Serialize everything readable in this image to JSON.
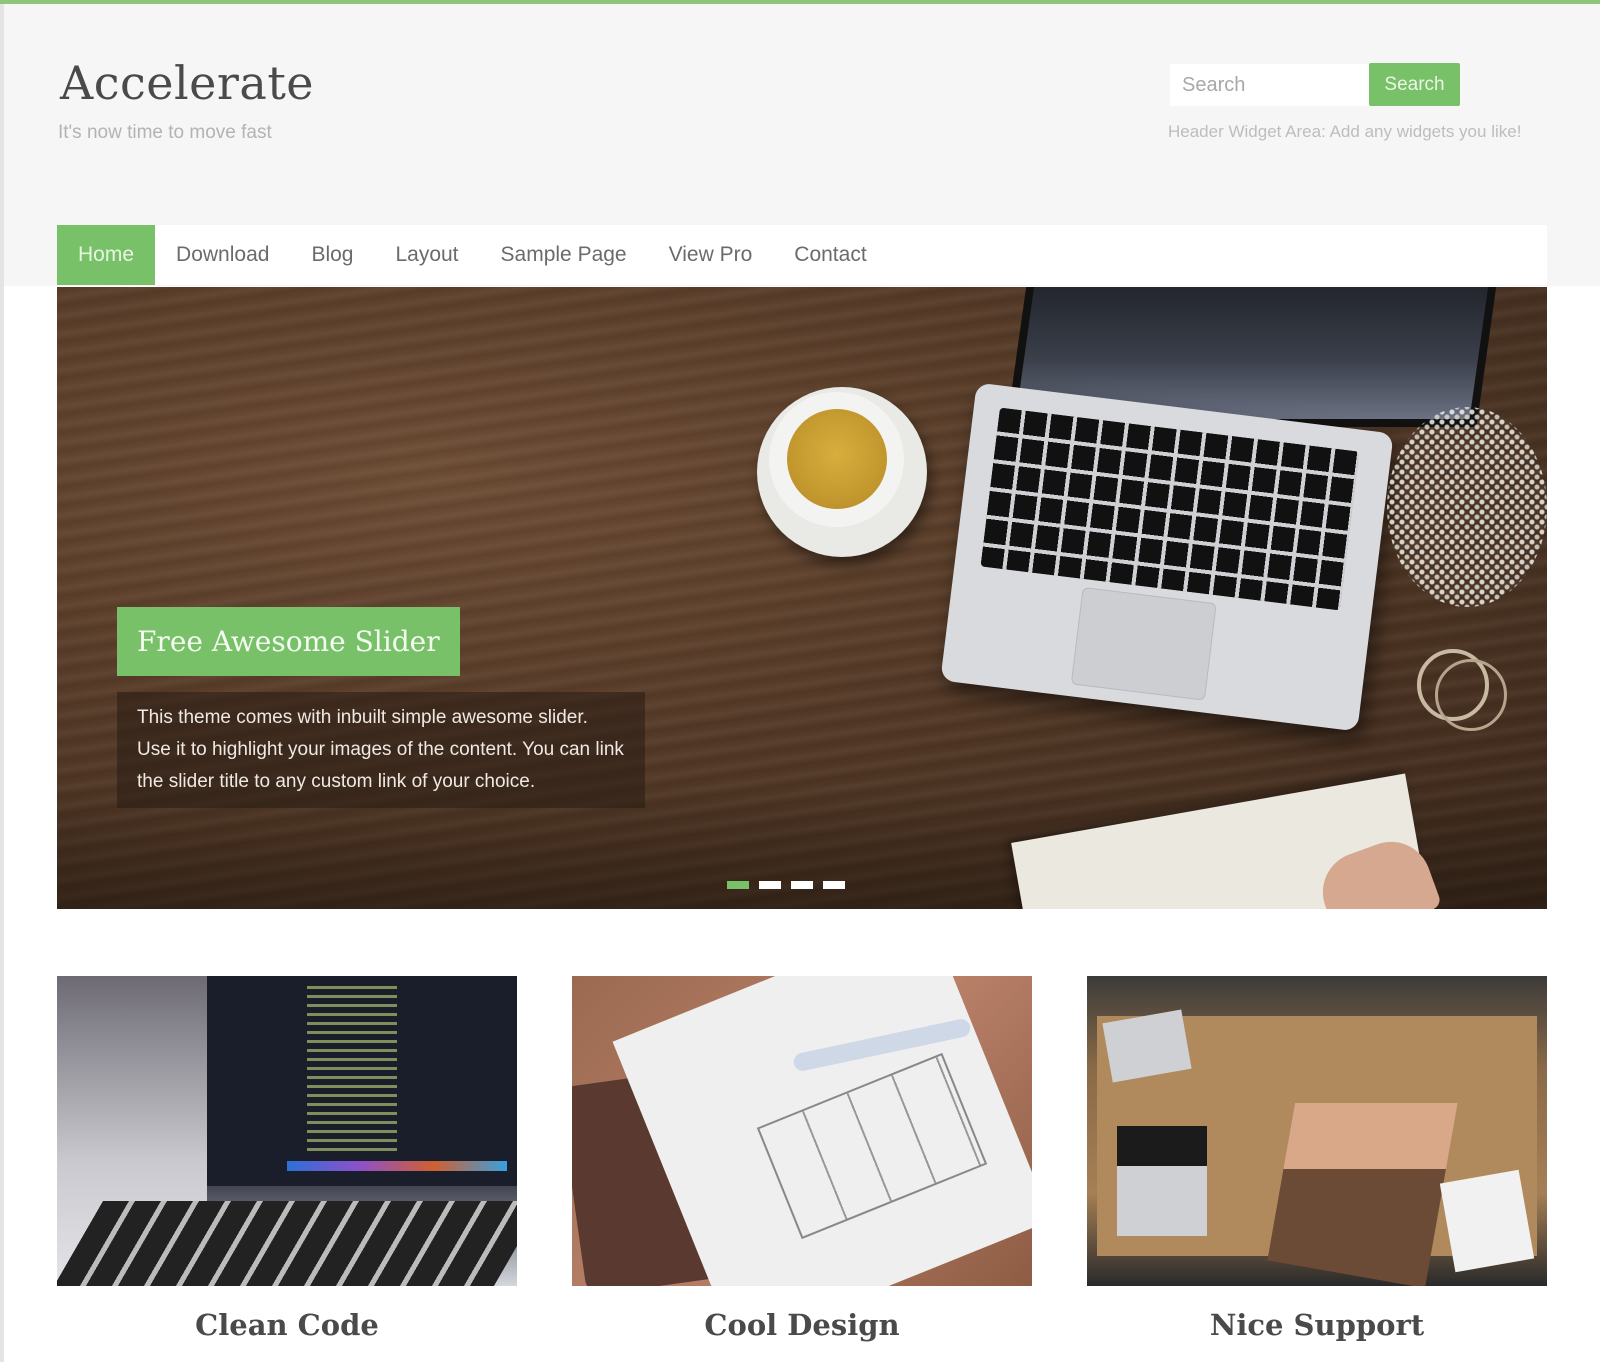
{
  "colors": {
    "accent": "#79c169",
    "header_bg": "#f6f6f6",
    "title_text": "#4a4a4a",
    "tagline_text": "#b3b3b3"
  },
  "header": {
    "site_title": "Accelerate",
    "tagline": "It's now time to move fast",
    "search": {
      "placeholder": "Search",
      "button_label": "Search"
    },
    "widget_text": "Header Widget Area: Add any widgets you like!"
  },
  "nav": {
    "items": [
      {
        "label": "Home",
        "active": true
      },
      {
        "label": "Download",
        "active": false
      },
      {
        "label": "Blog",
        "active": false
      },
      {
        "label": "Layout",
        "active": false
      },
      {
        "label": "Sample Page",
        "active": false
      },
      {
        "label": "View Pro",
        "active": false
      },
      {
        "label": "Contact",
        "active": false
      }
    ]
  },
  "slider": {
    "title": "Free Awesome Slider",
    "description": "This theme comes with inbuilt simple awesome slider. Use it to highlight your images of the content. You can link the slider title to any custom link of your choice.",
    "image_alt": "laptop-coffee-desk-photo",
    "slide_count": 4,
    "active_slide": 1
  },
  "features": [
    {
      "title": "Clean Code",
      "image": "laptop-code-photo"
    },
    {
      "title": "Cool Design",
      "image": "wireframe-sketch-photo"
    },
    {
      "title": "Nice Support",
      "image": "team-hands-photo"
    }
  ]
}
